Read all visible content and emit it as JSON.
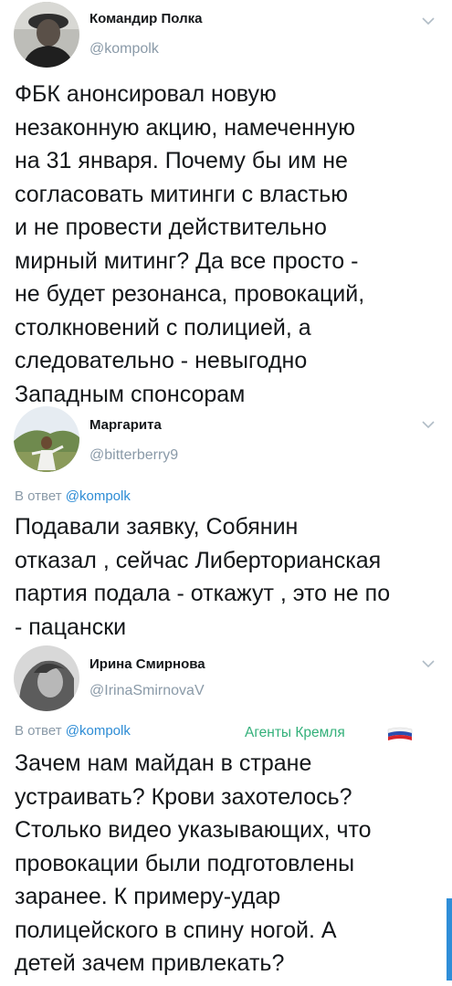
{
  "tweets": [
    {
      "name": "Командир Полка",
      "handle": "@kompolk",
      "avatar_icon": "user-avatar-photo",
      "text": "ФБК анонсировал новую\nнезаконную акцию, намеченную\nна 31 января. Почему бы им не\nсогласовать митинги с властью\nи не провести действительно\nмирный митинг? Да все просто -\nне будет резонанса, провокаций,\nстолкновений с полицией, а\nследовательно - невыгодно\nЗападным спонсорам"
    },
    {
      "name": "Маргарита",
      "handle": "@bitterberry9",
      "avatar_icon": "user-avatar-photo",
      "reply_prefix": "В ответ",
      "reply_to": "@kompolk",
      "text": "Подавали заявку, Собянин\nотказал , сейчас Либерторианская\nпартия подала - откажут , это не по\n- пацански"
    },
    {
      "name": "Ирина Смирнова",
      "handle": "@IrinaSmirnovaV",
      "avatar_icon": "user-avatar-photo",
      "reply_prefix": "В ответ",
      "reply_to": "@kompolk",
      "tag": "Агенты Кремля",
      "tag_icon": "russian-flag-icon",
      "text": "Зачем нам майдан в стране\nустраивать? Крови захотелось?\nСтолько видео указывающих, что\nпровокации были подготовлены\nзаранее. К примеру-удар\nполицейского в спину ногой. А\nдетей зачем привлекать?"
    }
  ],
  "colors": {
    "name": "#14171a",
    "handle": "#8a9aa8",
    "link": "#2d8cd5",
    "tag": "#33b07a",
    "scrollbar": "#2f8ed8"
  }
}
